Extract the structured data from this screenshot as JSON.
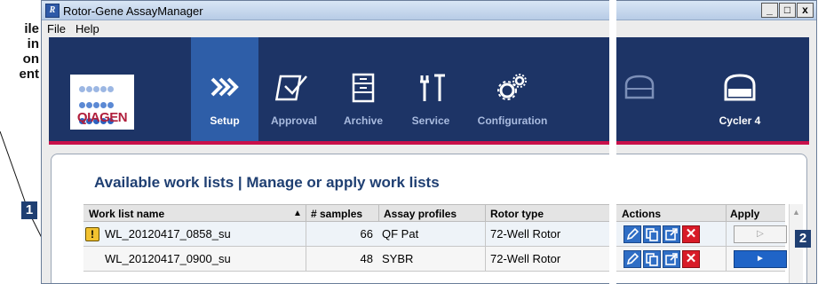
{
  "doc_snippet": [
    "ile",
    "in",
    "on",
    "ent"
  ],
  "callouts": [
    "1",
    "2"
  ],
  "window": {
    "title": "Rotor-Gene AssayManager",
    "controls": [
      "_",
      "□",
      "x"
    ]
  },
  "menu": [
    "File",
    "Help"
  ],
  "logo": {
    "text": "QIAGEN"
  },
  "nav": [
    {
      "label": "Setup",
      "icon": "setup-icon",
      "active": true
    },
    {
      "label": "Approval",
      "icon": "approval-icon",
      "active": false
    },
    {
      "label": "Archive",
      "icon": "archive-icon",
      "active": false
    },
    {
      "label": "Service",
      "icon": "service-icon",
      "active": false
    },
    {
      "label": "Configuration",
      "icon": "configuration-icon",
      "active": false
    },
    {
      "label": "Cycler 4",
      "icon": "cycler-icon",
      "active": false
    }
  ],
  "panel": {
    "title": "Available work lists | Manage or apply work lists",
    "columns": [
      "Work list name",
      "# samples",
      "Assay profiles",
      "Rotor type",
      "Actions",
      "Apply"
    ],
    "sort_indicator": "▲",
    "rows": [
      {
        "warning": "!",
        "name": "WL_20120417_0858_su",
        "samples": "66",
        "assay": "QF Pat",
        "rotor": "72-Well Rotor",
        "apply_enabled": false
      },
      {
        "warning": "",
        "name": "WL_20120417_0900_su",
        "samples": "48",
        "assay": "SYBR",
        "rotor": "72-Well Rotor",
        "apply_enabled": true
      }
    ],
    "delete_glyph": "✕",
    "apply_glyph": "▷",
    "apply_glyph_on": "►"
  },
  "colors": {
    "nav_bg": "#1d3466",
    "nav_active": "#2e5ea8",
    "accent_red": "#c8104a",
    "title_blue": "#1f3f72"
  }
}
